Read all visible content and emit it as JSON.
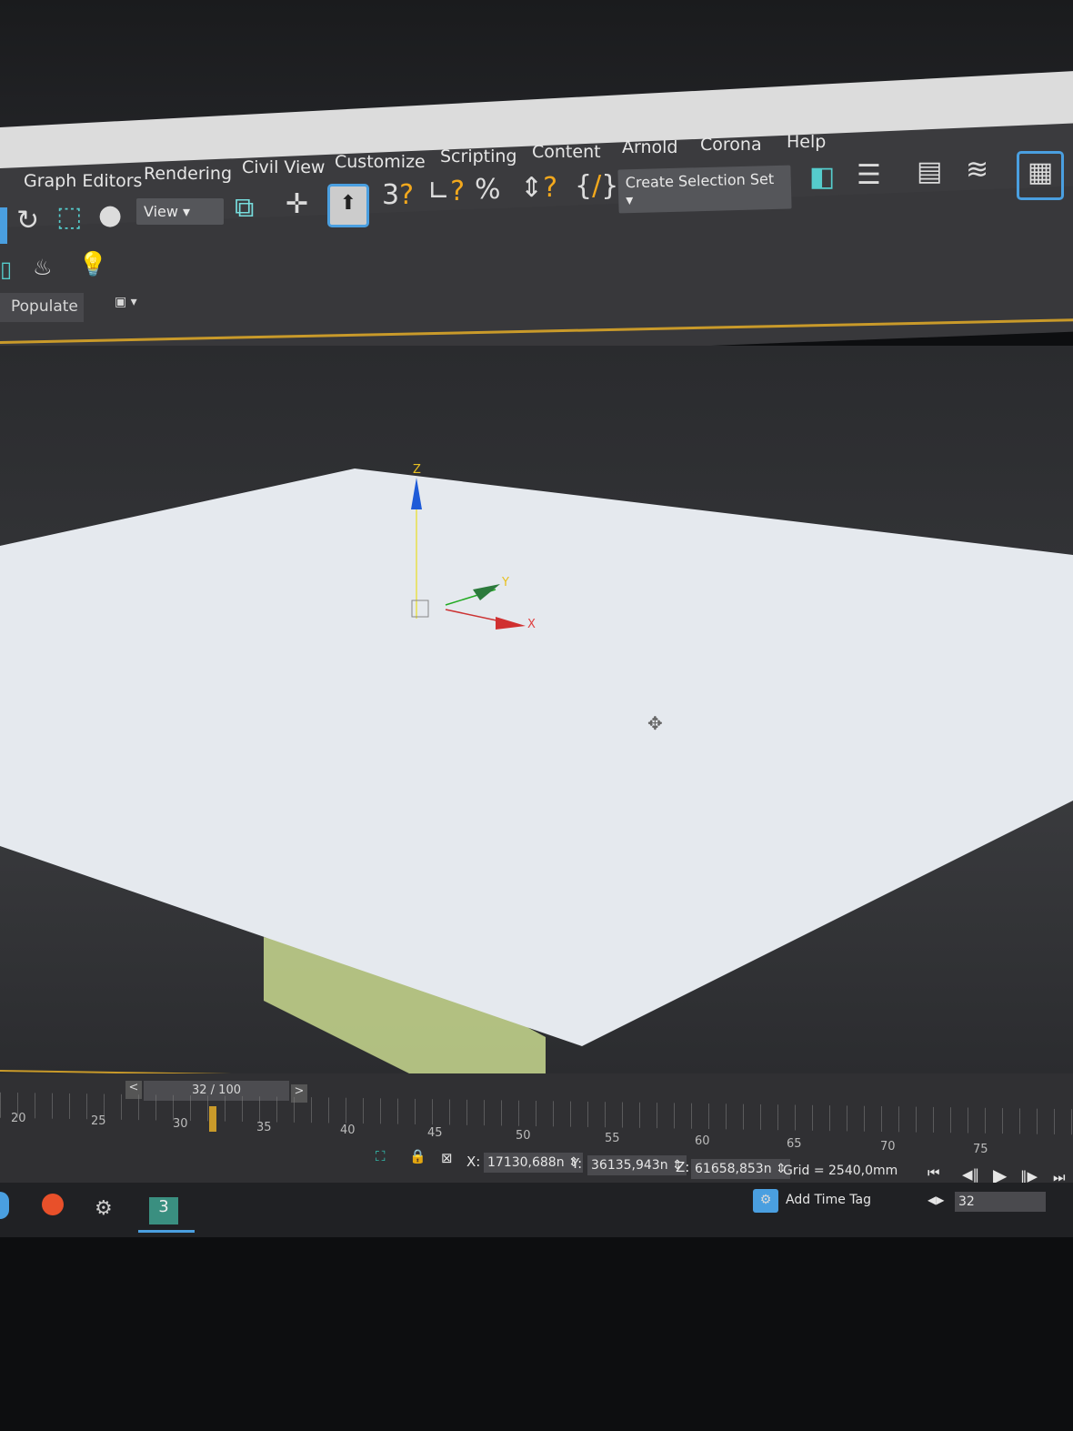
{
  "menu": [
    "Graph Editors",
    "Rendering",
    "Civil View",
    "Customize",
    "Scripting",
    "Content",
    "Arnold",
    "Corona",
    "Help"
  ],
  "toolbar": {
    "view_dropdown": "View",
    "selection_set": "Create Selection Set",
    "populate_tab": "Populate"
  },
  "viewport": {
    "axis_x": "X",
    "axis_y": "Y",
    "axis_z": "Z",
    "plane_color": "#e8ecef",
    "object_color": "#c9d98f"
  },
  "timeline": {
    "slider": "32 / 100",
    "prev": "<",
    "next": ">",
    "ticks": [
      "20",
      "25",
      "30",
      "35",
      "40",
      "45",
      "50",
      "55",
      "60",
      "65",
      "70",
      "75"
    ]
  },
  "status": {
    "x_label": "X:",
    "x": "17130,688n",
    "y_label": "Y:",
    "y": "36135,943n",
    "z_label": "Z:",
    "z": "61658,853n",
    "grid": "Grid = 2540,0mm",
    "add_time_tag": "Add Time Tag",
    "frame": "32"
  },
  "accent": "#4a9fe0"
}
